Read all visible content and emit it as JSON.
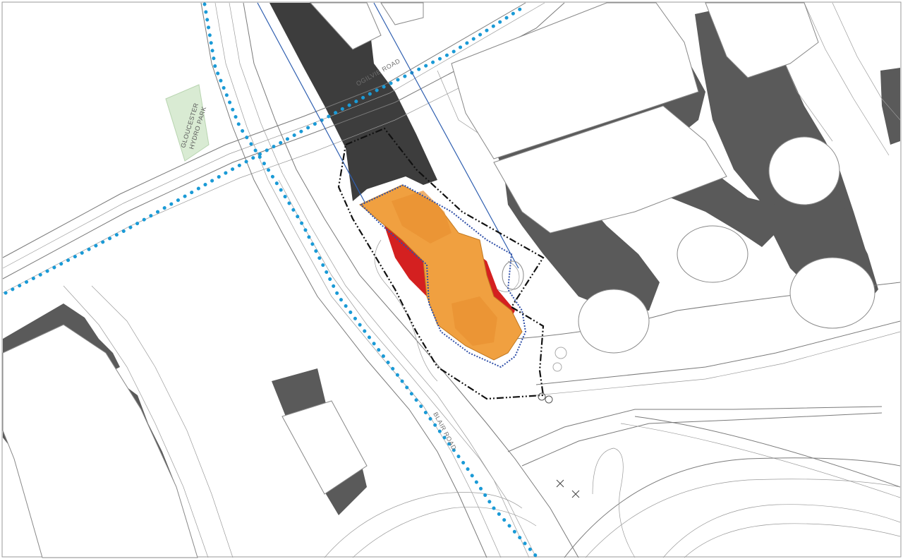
{
  "map": {
    "labels": {
      "park_line1": "GLOUCESTER",
      "park_line2": "HYDRO PARK",
      "road_ogilvie": "OGILVIE ROAD",
      "road_blair": "BLAIR ROAD"
    },
    "colors": {
      "background": "#ffffff",
      "shadow": "#5a5a5a",
      "shadow_dark": "#3d3d3d",
      "transit_line": "#1a9ad6",
      "building_orange": "#f0a040",
      "building_red": "#d42020",
      "park_green": "#d9ebd3",
      "site_boundary": "#111111",
      "setback_blue": "#2f5fb0"
    }
  }
}
